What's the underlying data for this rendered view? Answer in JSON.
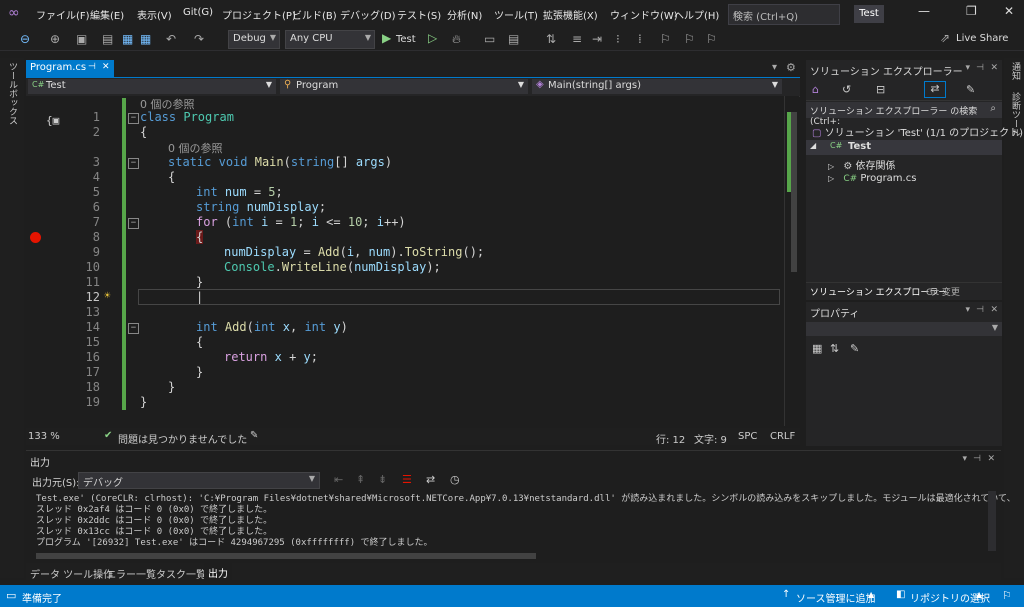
{
  "menu": {
    "items": [
      "ファイル(F)",
      "編集(E)",
      "表示(V)",
      "Git(G)",
      "プロジェクト(P)",
      "ビルド(B)",
      "デバッグ(D)",
      "テスト(S)",
      "分析(N)",
      "ツール(T)",
      "拡張機能(X)",
      "ウィンドウ(W)",
      "ヘルプ(H)"
    ],
    "search_placeholder": "検索 (Ctrl+Q)",
    "solution_name": "Test"
  },
  "toolbar": {
    "config": "Debug",
    "platform": "Any CPU",
    "run_target": "Test",
    "live_share": "Live Share"
  },
  "left_sidebar": {
    "toolbox": "ツールボックス"
  },
  "right_sidebar": {
    "notifications": "通知",
    "diagnostic": "診断ツール"
  },
  "editor": {
    "tab_label": "Program.cs",
    "nav_project": "Test",
    "nav_class": "Program",
    "nav_member": "Main(string[] args)",
    "ref_count_1": "0 個の参照",
    "ref_count_2": "0 個の参照",
    "line_numbers": [
      "1",
      "2",
      "3",
      "4",
      "5",
      "6",
      "7",
      "8",
      "9",
      "10",
      "11",
      "12",
      "13",
      "14",
      "15",
      "16",
      "17",
      "18",
      "19"
    ],
    "current_line": "12",
    "breakpoint_line": "8"
  },
  "editor_status": {
    "zoom": "133 %",
    "issues": "問題は見つかりませんでした",
    "line": "行: 12",
    "col": "文字: 9",
    "spc": "SPC",
    "crlf": "CRLF"
  },
  "solution_explorer": {
    "title": "ソリューション エクスプローラー",
    "search": "ソリューション エクスプローラー の検索 (Ctrl+:",
    "root": "ソリューション 'Test' (1/1 のプロジェクト)",
    "project": "Test",
    "deps": "依存関係",
    "file": "Program.cs",
    "tab1": "ソリューション エクスプローラー",
    "tab2": "Git 変更"
  },
  "properties": {
    "title": "プロパティ"
  },
  "output": {
    "title": "出力",
    "source_label": "出力元(S):",
    "source_value": "デバッグ",
    "lines": [
      "Test.exe' (CoreCLR: clrhost): 'C:¥Program Files¥dotnet¥shared¥Microsoft.NETCore.App¥7.0.13¥netstandard.dll' が読み込まれました。シンボルの読み込みをスキップしました。モジュールは最適化されていて、",
      "スレッド 0x2af4 はコード 0 (0x0) で終了しました。",
      "スレッド 0x2ddc はコード 0 (0x0) で終了しました。",
      "スレッド 0x13cc はコード 0 (0x0) で終了しました。",
      "プログラム '[26932] Test.exe' はコード 4294967295 (0xffffffff) で終了しました。"
    ]
  },
  "bottom_tabs": [
    "データ ツール操作",
    "エラー一覧",
    "タスク一覧",
    "出力"
  ],
  "statusbar": {
    "ready": "準備完了",
    "source_control": "ソース管理に追加",
    "repo": "リポジトリの選択"
  },
  "colors": {
    "accent": "#007acc",
    "breakpoint": "#e51400",
    "change_bar": "#57a64a"
  }
}
